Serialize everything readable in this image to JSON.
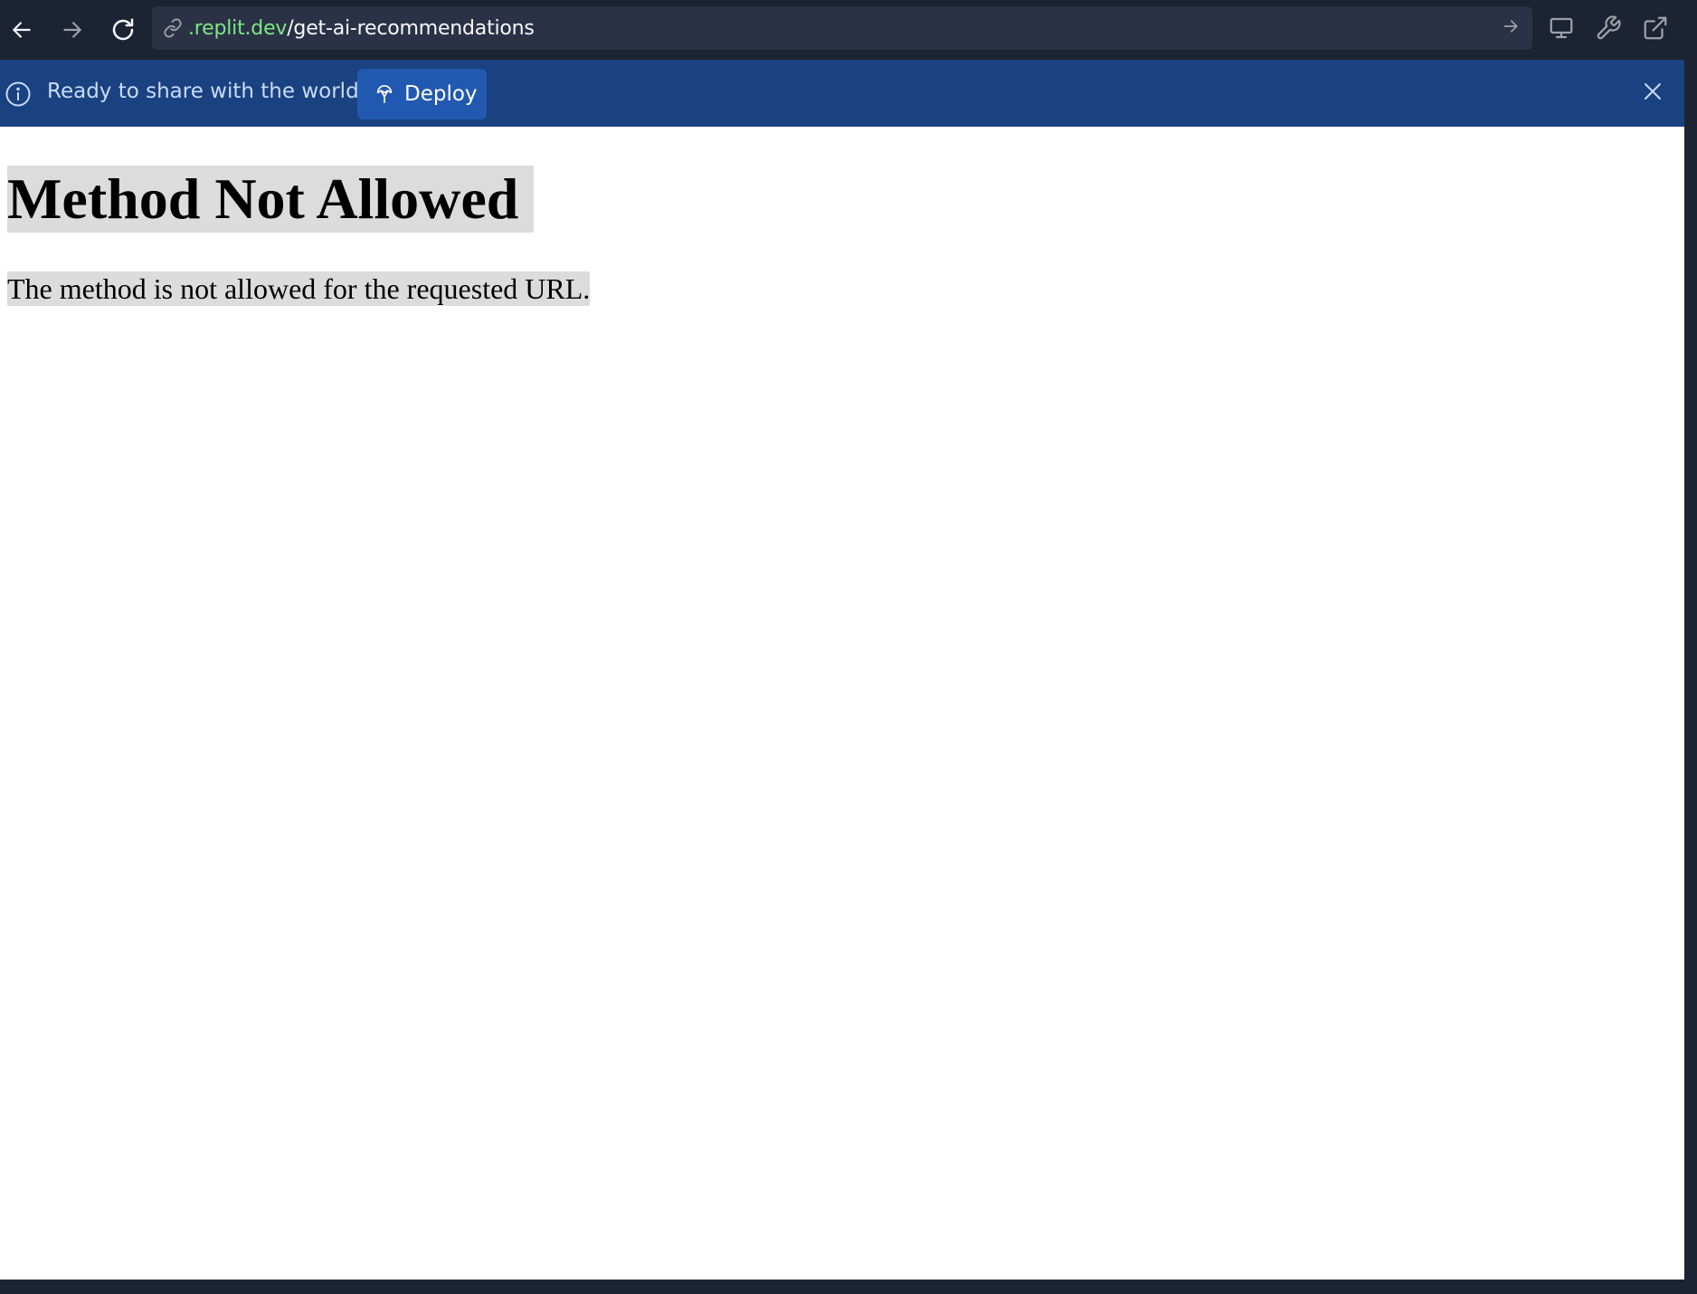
{
  "toolbar": {
    "back_icon": "arrow-left-icon",
    "forward_icon": "arrow-right-icon",
    "reload_icon": "reload-icon",
    "url_bar": {
      "link_icon": "link-icon",
      "domain": ".replit.dev",
      "path": "/get-ai-recommendations",
      "go_icon": "arrow-right-icon"
    },
    "tools": {
      "devices_icon": "monitor-icon",
      "devtools_icon": "wrench-icon",
      "open_new_tab_icon": "external-link-icon"
    }
  },
  "banner": {
    "info_icon": "info-icon",
    "message": "Ready to share with the world?",
    "deploy_button": {
      "icon": "deploy-icon",
      "label": "Deploy"
    },
    "close_icon": "close-icon"
  },
  "page": {
    "title": "Method Not Allowed",
    "message": "The method is not allowed for the requested URL."
  },
  "colors": {
    "chrome_bg": "#1c2333",
    "url_bar_bg": "#2b3245",
    "domain_green": "#7ee787",
    "banner_bg": "#1a4180",
    "deploy_button_bg": "#2259b0",
    "banner_text": "#c9dbf7",
    "page_bg": "#ffffff",
    "highlight": "#dcdcdc"
  }
}
